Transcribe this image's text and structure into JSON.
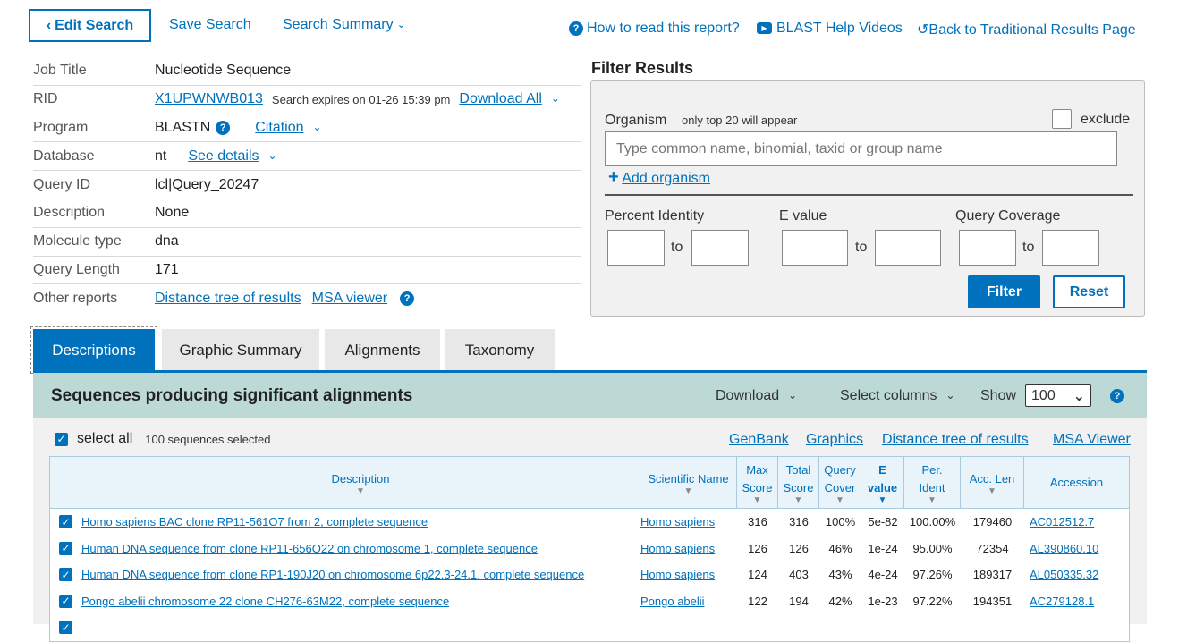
{
  "nav": {
    "edit_search": "Edit Search",
    "save_search": "Save Search",
    "search_summary": "Search Summary",
    "how_to_read": "How to read this report?",
    "help_videos": "BLAST Help Videos",
    "back_traditional": "Back to Traditional Results Page"
  },
  "job": {
    "rows": [
      {
        "label": "Job Title",
        "value": "Nucleotide Sequence"
      },
      {
        "label": "RID",
        "value": "X1UPWNWB013",
        "expires": "Search expires on 01-26 15:39 pm",
        "download": "Download All"
      },
      {
        "label": "Program",
        "value": "BLASTN",
        "citation": "Citation"
      },
      {
        "label": "Database",
        "value": "nt",
        "details": "See details"
      },
      {
        "label": "Query ID",
        "value": "lcl|Query_20247"
      },
      {
        "label": "Description",
        "value": "None"
      },
      {
        "label": "Molecule type",
        "value": "dna"
      },
      {
        "label": "Query Length",
        "value": "171"
      },
      {
        "label": "Other reports",
        "link1": "Distance tree of results",
        "link2": "MSA viewer"
      }
    ]
  },
  "filter": {
    "title": "Filter Results",
    "organism_label": "Organism",
    "organism_note": "only top 20 will appear",
    "exclude": "exclude",
    "organism_placeholder": "Type common  name, binomial, taxid or group  name",
    "add_organism": "Add organism",
    "percent_identity": "Percent Identity",
    "e_value": "E value",
    "query_coverage": "Query Coverage",
    "to": "to",
    "filter_btn": "Filter",
    "reset_btn": "Reset"
  },
  "tabs": [
    "Descriptions",
    "Graphic Summary",
    "Alignments",
    "Taxonomy"
  ],
  "results": {
    "title": "Sequences producing significant alignments",
    "download": "Download",
    "select_columns": "Select columns",
    "show": "Show",
    "show_value": "100",
    "select_all": "select all",
    "selected_count": "100 sequences selected",
    "links": [
      "GenBank",
      "Graphics",
      "Distance tree of results",
      "MSA Viewer"
    ],
    "columns": {
      "description": "Description",
      "scientific_name": "Scientific Name",
      "max_score_1": "Max",
      "max_score_2": "Score",
      "total_score_1": "Total",
      "total_score_2": "Score",
      "query_cover_1": "Query",
      "query_cover_2": "Cover",
      "evalue_1": "E",
      "evalue_2": "value",
      "per_ident_1": "Per.",
      "per_ident_2": "Ident",
      "acc_len": "Acc. Len",
      "accession": "Accession"
    },
    "rows": [
      {
        "description": "Homo sapiens BAC clone RP11-561O7 from 2, complete sequence",
        "sci": "Homo sapiens",
        "max": "316",
        "total": "316",
        "cover": "100%",
        "evalue": "5e-82",
        "ident": "100.00%",
        "len": "179460",
        "acc": "AC012512.7"
      },
      {
        "description": "Human DNA sequence from clone RP11-656O22 on chromosome 1, complete sequence",
        "sci": "Homo sapiens",
        "max": "126",
        "total": "126",
        "cover": "46%",
        "evalue": "1e-24",
        "ident": "95.00%",
        "len": "72354",
        "acc": "AL390860.10"
      },
      {
        "description": "Human DNA sequence from clone RP1-190J20 on chromosome 6p22.3-24.1, complete sequence",
        "sci": "Homo sapiens",
        "max": "124",
        "total": "403",
        "cover": "43%",
        "evalue": "4e-24",
        "ident": "97.26%",
        "len": "189317",
        "acc": "AL050335.32"
      },
      {
        "description": "Pongo abelii chromosome 22 clone CH276-63M22, complete sequence",
        "sci": "Pongo abelii",
        "max": "122",
        "total": "194",
        "cover": "42%",
        "evalue": "1e-23",
        "ident": "97.22%",
        "len": "194351",
        "acc": "AC279128.1"
      }
    ]
  }
}
